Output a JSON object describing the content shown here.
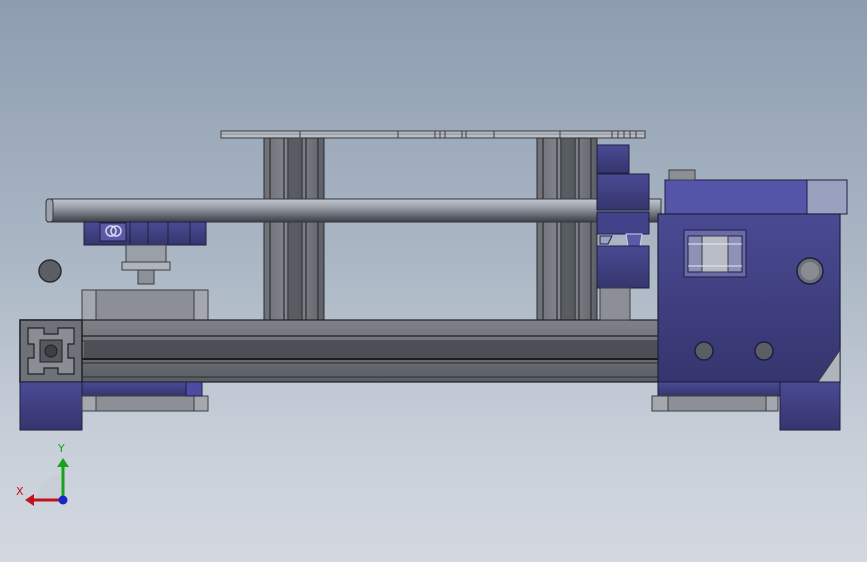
{
  "viewport": {
    "background_top": "#8d9db0",
    "background_bottom": "#d3d8e0"
  },
  "model": {
    "body_color": "#3d3d80",
    "rail_color": "#6a6e74",
    "shaft_color": "#8a8e96"
  },
  "triad": {
    "x_label": "X",
    "y_label": "Y",
    "x_color": "#c0141c",
    "y_color": "#17a21c",
    "z_color": "#1a24c8"
  }
}
